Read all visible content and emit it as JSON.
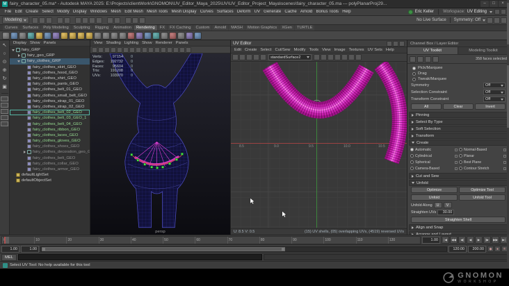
{
  "window": {
    "app_icon": "M",
    "title": "fairy_character_05.ma* - Autodesk MAYA 2025: E:\\Projects\\clientWork\\GNOMON\\UV_Editor_Maya_2025\\UV\\UV_Editor_Project_Maya\\scenes\\fairy_character_05.ma  ---  polyPlanarProj29...",
    "controls": [
      {
        "name": "minimize-button",
        "g": "–"
      },
      {
        "name": "maximize-button",
        "g": "□"
      },
      {
        "name": "close-button",
        "g": "×"
      }
    ]
  },
  "menubar": {
    "items": [
      "File",
      "Edit",
      "Create",
      "Select",
      "Modify",
      "Display",
      "Windows",
      "Mesh",
      "Edit Mesh",
      "Mesh Tools",
      "Mesh Display",
      "Curves",
      "Surfaces",
      "Deform",
      "UV",
      "Generate",
      "Cache",
      "Arnold",
      "Bonus Tools",
      "Help"
    ],
    "user": "Eric Keller",
    "workspace_label": "Workspace:",
    "workspace_value": "UV Editing",
    "right_icons": [
      {
        "name": "workspace-save-icon"
      },
      {
        "name": "workspace-reset-icon"
      }
    ]
  },
  "statusline": {
    "mode": "Modeling",
    "icons": [
      {
        "name": "new-scene-icon"
      },
      {
        "name": "open-scene-icon"
      },
      {
        "name": "save-scene-icon"
      },
      {
        "name": "undo-icon",
        "sep": "sep"
      },
      {
        "name": "redo-icon"
      },
      {
        "name": "snap-grid-icon",
        "sep": "sep"
      },
      {
        "name": "snap-curve-icon"
      },
      {
        "name": "snap-point-icon"
      },
      {
        "name": "snap-plane-icon"
      },
      {
        "name": "make-live-icon",
        "sep": "sep"
      },
      {
        "name": "construction-history-icon"
      },
      {
        "name": "render-frame-icon",
        "sep": "sep"
      },
      {
        "name": "ipr-render-icon"
      },
      {
        "name": "render-settings-icon"
      }
    ],
    "live_surface": "No Live Surface",
    "symmetry": "Symmetry: Off",
    "right_icons": [
      {
        "name": "toggle-attribute-editor-icon"
      },
      {
        "name": "toggle-tool-settings-icon"
      },
      {
        "name": "toggle-channel-box-icon"
      }
    ]
  },
  "shelf": {
    "tabs": [
      {
        "label": "Curves"
      },
      {
        "label": "Surfaces"
      },
      {
        "label": "Poly Modeling"
      },
      {
        "label": "Sculpting"
      },
      {
        "label": "Rigging"
      },
      {
        "label": "Animation"
      },
      {
        "label": "Rendering",
        "state": "active"
      },
      {
        "label": "FX"
      },
      {
        "label": "FX Caching"
      },
      {
        "label": "Custom"
      },
      {
        "label": "Arnold"
      },
      {
        "label": "MASH"
      },
      {
        "label": "Motion Graphics"
      },
      {
        "label": "XGen"
      },
      {
        "label": "TURTLE"
      }
    ],
    "icons": [
      {
        "name": "render-view-icon",
        "c": "c2"
      },
      {
        "name": "ipr-render-icon",
        "c": "c1"
      },
      {
        "name": "render-settings-icon",
        "c": "c2"
      },
      {
        "name": "hypershade-icon",
        "c": "c4"
      },
      {
        "name": "light-editor-icon",
        "c": "c3"
      },
      {
        "name": "standard-surface-icon",
        "c": "c1"
      },
      {
        "name": "ai-standard-surface-icon",
        "c": "c6"
      },
      {
        "name": "area-light-icon",
        "c": "c3"
      },
      {
        "name": "skydome-light-icon",
        "c": "c3"
      },
      {
        "name": "mesh-light-icon",
        "c": "c3"
      },
      {
        "name": "photometric-light-icon",
        "c": "c3"
      },
      {
        "name": "point-light-icon",
        "c": "c2"
      },
      {
        "name": "spot-light-icon",
        "c": "c2"
      },
      {
        "name": "directional-light-icon",
        "c": "c2"
      },
      {
        "name": "ambient-light-icon",
        "c": "c2"
      },
      {
        "name": "volume-light-icon",
        "c": "c5"
      },
      {
        "name": "shadows-icon",
        "c": "c6"
      },
      {
        "name": "raytrace-icon",
        "c": "c1"
      },
      {
        "name": "env-ball-icon",
        "c": "c4"
      },
      {
        "name": "file-texture-icon",
        "c": "c2"
      },
      {
        "name": "ramp-texture-icon",
        "c": "c5"
      },
      {
        "name": "checker-texture-icon",
        "c": "c2"
      },
      {
        "name": "noise-texture-icon",
        "c": "c6"
      },
      {
        "name": "bump-node-icon",
        "c": "c1"
      }
    ]
  },
  "toolbox": {
    "tools": [
      {
        "name": "select-tool-icon",
        "g": "↖"
      },
      {
        "name": "lasso-tool-icon",
        "g": "○"
      },
      {
        "name": "paint-select-tool-icon",
        "g": "⊙"
      },
      {
        "name": "move-tool-icon",
        "g": "⊕"
      },
      {
        "name": "rotate-tool-icon",
        "g": "↻"
      },
      {
        "name": "scale-tool-icon",
        "g": "▣"
      }
    ],
    "layouts": [
      {
        "name": "layout-single-pane"
      },
      {
        "name": "layout-four-pane"
      },
      {
        "name": "layout-two-side"
      },
      {
        "name": "layout-two-stacked"
      },
      {
        "name": "layout-persp-outliner"
      }
    ]
  },
  "outliner": {
    "menus": [
      "Display",
      "Show",
      "Panels"
    ],
    "items": [
      {
        "label": "fairy_GRP",
        "lvl": "l1",
        "arrow": "open",
        "icon": "icon-group"
      },
      {
        "label": "fairy_geo_GRP",
        "lvl": "l2",
        "arrow": "closed",
        "icon": "icon-group"
      },
      {
        "label": "fairy_clothes_GRP",
        "lvl": "l2",
        "arrow": "open",
        "icon": "icon-group",
        "state": "sel-row"
      },
      {
        "label": "fairy_clothes_skirt_GEO",
        "lvl": "l3",
        "arrow": "none",
        "icon": "icon-mesh"
      },
      {
        "label": "fairy_clothes_hood_GEO",
        "lvl": "l3",
        "arrow": "none",
        "icon": "icon-mesh"
      },
      {
        "label": "fairy_clothes_shirt_GEO",
        "lvl": "l3",
        "arrow": "none",
        "icon": "icon-mesh"
      },
      {
        "label": "fairy_clothes_pants_GEO",
        "lvl": "l3",
        "arrow": "none",
        "icon": "icon-mesh"
      },
      {
        "label": "fairy_clothes_belt_01_GEO",
        "lvl": "l3",
        "arrow": "none",
        "icon": "icon-mesh"
      },
      {
        "label": "fairy_clothes_small_belt_GEO",
        "lvl": "l3",
        "arrow": "none",
        "icon": "icon-mesh"
      },
      {
        "label": "fairy_clothes_strap_01_GEO",
        "lvl": "l3",
        "arrow": "none",
        "icon": "icon-mesh"
      },
      {
        "label": "fairy_clothes_strap_02_GEO",
        "lvl": "l3",
        "arrow": "none",
        "icon": "icon-mesh"
      },
      {
        "label": "fairy_clothes_belt_02_GEO",
        "lvl": "l3",
        "arrow": "none",
        "icon": "icon-mesh",
        "state": "active-row grn"
      },
      {
        "label": "fairy_clothes_belt_03_GEO_1",
        "lvl": "l3",
        "arrow": "none",
        "icon": "icon-mesh",
        "state": "grn"
      },
      {
        "label": "fairy_clothes_belt_04_GEO",
        "lvl": "l3",
        "arrow": "none",
        "icon": "icon-mesh",
        "state": "grn"
      },
      {
        "label": "fairy_clothes_ribbon_GEO",
        "lvl": "l3",
        "arrow": "none",
        "icon": "icon-mesh",
        "state": "grn"
      },
      {
        "label": "fairy_clothes_laces_GEO",
        "lvl": "l3",
        "arrow": "none",
        "icon": "icon-mesh",
        "state": "grn"
      },
      {
        "label": "fairy_clothes_gloves_GEO",
        "lvl": "l3",
        "arrow": "none",
        "icon": "icon-mesh",
        "state": "grn"
      },
      {
        "label": "fairy_clothes_shoes_GEO",
        "lvl": "l3",
        "arrow": "none",
        "icon": "icon-mesh",
        "state": "dim"
      },
      {
        "label": "fairy_clothes_decoration_geo_GRP",
        "lvl": "l3",
        "arrow": "closed",
        "icon": "icon-group",
        "state": "dim"
      },
      {
        "label": "fairy_clothes_belt_GEO",
        "lvl": "l3",
        "arrow": "none",
        "icon": "icon-mesh",
        "state": "dim"
      },
      {
        "label": "fairy_clothes_collar_GEO",
        "lvl": "l3",
        "arrow": "none",
        "icon": "icon-mesh",
        "state": "dim"
      },
      {
        "label": "fairy_clothes_armor_GEO",
        "lvl": "l3",
        "arrow": "none",
        "icon": "icon-mesh",
        "state": "dim"
      },
      {
        "label": "defaultLightSet",
        "lvl": "l1",
        "arrow": "none",
        "icon": "icon-set"
      },
      {
        "label": "defaultObjectSet",
        "lvl": "l1",
        "arrow": "none",
        "icon": "icon-set"
      }
    ]
  },
  "viewport": {
    "menus": [
      "View",
      "Shading",
      "Lighting",
      "Show",
      "Renderer",
      "Panels"
    ],
    "icons": [
      {
        "name": "select-camera-icon"
      },
      {
        "name": "lock-camera-icon"
      },
      {
        "name": "camera-attributes-icon"
      },
      {
        "name": "bookmarks-icon"
      },
      {
        "name": "image-plane-icon"
      },
      {
        "name": "2d-pan-zoom-icon"
      },
      {
        "name": "wireframe-mode-icon"
      },
      {
        "name": "shaded-mode-icon"
      },
      {
        "name": "textured-mode-icon"
      },
      {
        "name": "use-all-lights-icon"
      },
      {
        "name": "shadows-icon"
      },
      {
        "name": "screen-space-ao-icon"
      },
      {
        "name": "anti-aliasing-icon"
      },
      {
        "name": "isolate-select-icon"
      },
      {
        "name": "xray-icon"
      },
      {
        "name": "xray-joints-icon"
      }
    ],
    "hud": [
      {
        "label": "Verts:",
        "value": "97154",
        "sel": "0"
      },
      {
        "label": "Edges:",
        "value": "192732",
        "sel": "0"
      },
      {
        "label": "Faces:",
        "value": "95604",
        "sel": "0"
      },
      {
        "label": "Tris:",
        "value": "191208",
        "sel": "0"
      },
      {
        "label": "UVs:",
        "value": "103970",
        "sel": "0"
      }
    ],
    "camera": "persp"
  },
  "uv_editor": {
    "title": "UV Editor",
    "title_icons": [
      {
        "name": "panel-menu-icon"
      },
      {
        "name": "panel-float-icon"
      },
      {
        "name": "panel-close-icon"
      }
    ],
    "menus": [
      "Edit",
      "Create",
      "Select",
      "Cut/Sew",
      "Modify",
      "Tools",
      "View",
      "Image",
      "Textures",
      "UV Sets",
      "Help"
    ],
    "toolbar_icons_a": [
      {
        "name": "uv-grab-icon"
      },
      {
        "name": "uv-flip-u-icon"
      },
      {
        "name": "uv-flip-v-icon"
      },
      {
        "name": "uv-rotate-ccw-icon"
      },
      {
        "name": "uv-rotate-cw-icon"
      }
    ],
    "texture_dropdown": "standardSurface2",
    "toolbar_icons_b": [
      {
        "name": "grid-snap-icon"
      },
      {
        "name": "pixel-snap-icon"
      },
      {
        "name": "texture-borders-icon"
      },
      {
        "name": "checker-map-icon"
      },
      {
        "name": "shade-uvs-icon"
      },
      {
        "name": "distortion-display-icon"
      },
      {
        "name": "isolate-select-icon"
      }
    ],
    "ticks": [
      "8.5",
      "9.0",
      "9.5",
      "10.0",
      "10.5"
    ],
    "coords": "U: 8.5    V: 0.5",
    "stats": "(15) UV shells,  (05) overlapping UVs,  (4519) reversed UVs"
  },
  "toolkit": {
    "tab_top": "Channel Box / Layer Editor",
    "tabs": [
      {
        "label": "UV Toolkit",
        "state": "active"
      },
      {
        "label": "Modeling Toolkit"
      }
    ],
    "mode_icons": [
      {
        "name": "uv-select-mode-icon"
      },
      {
        "name": "edge-select-mode-icon"
      },
      {
        "name": "face-select-mode-icon"
      },
      {
        "name": "shell-select-mode-icon"
      }
    ],
    "selection_info": "358 faces selected",
    "select_modes": [
      {
        "label": "Pick/Marquee",
        "on": "on"
      },
      {
        "label": "Drag"
      },
      {
        "label": "Tweak/Marquee"
      }
    ],
    "symmetry_label": "Symmetry",
    "symmetry_value": "Off",
    "selection_constraint_label": "Selection Constraint",
    "selection_constraint_value": "Off",
    "transform_constraint_label": "Transform Constraint",
    "transform_constraint_value": "Off",
    "select_buttons": [
      "All",
      "Clear",
      "Invert"
    ],
    "sections": [
      {
        "title": "Pinning"
      },
      {
        "title": "Select By Type"
      },
      {
        "title": "Soft Selection"
      },
      {
        "title": "Transform"
      },
      {
        "title": "Create"
      },
      {
        "title": "Cut and Sew"
      },
      {
        "title": "Unfold"
      },
      {
        "title": "Align and Snap"
      },
      {
        "title": "Arrange and Layout"
      }
    ],
    "create_items": [
      {
        "label": "Automatic",
        "on": "on"
      },
      {
        "label": "Normal-Based"
      },
      {
        "label": "Cylindrical"
      },
      {
        "label": "Planar"
      },
      {
        "label": "Spherical"
      },
      {
        "label": "Best Plane"
      },
      {
        "label": "Camera-Based"
      },
      {
        "label": "Contour Stretch"
      }
    ],
    "unfold": {
      "optimize": "Optimize",
      "optimize_tool": "Optimize Tool",
      "unfold": "Unfold",
      "unfold_tool": "Unfold Tool",
      "unfold_along": "Unfold Along",
      "u": "U",
      "v": "V",
      "straighten_uvs": "Straighten UVs",
      "angle": "30.00",
      "straighten_shell": "Straighten Shell"
    }
  },
  "timeline": {
    "ticks": [
      "0",
      "10",
      "20",
      "30",
      "40",
      "50",
      "60",
      "70",
      "80",
      "90",
      "100",
      "110",
      "120"
    ],
    "current": "1.00",
    "transports": [
      {
        "name": "go-to-start-button",
        "g": "|◀"
      },
      {
        "name": "step-back-key-button",
        "g": "◀◀"
      },
      {
        "name": "step-back-frame-button",
        "g": "◀|"
      },
      {
        "name": "play-backwards-button",
        "g": "◀"
      },
      {
        "name": "play-forwards-button",
        "g": "▶"
      },
      {
        "name": "step-forward-frame-button",
        "g": "|▶"
      },
      {
        "name": "step-forward-key-button",
        "g": "▶▶"
      },
      {
        "name": "go-to-end-button",
        "g": "▶|"
      }
    ]
  },
  "rangeslider": {
    "start_outer": "1.00",
    "start_inner": "1.00",
    "end_inner": "120.00",
    "end_outer": "200.00",
    "icons": [
      {
        "name": "playback-options-icon",
        "g": "◆"
      },
      {
        "name": "auto-key-icon",
        "g": "●"
      },
      {
        "name": "animation-preferences-icon",
        "g": "✳"
      }
    ]
  },
  "commandline": {
    "label": "MEL",
    "value": ""
  },
  "helpline": {
    "text": "Select UV Tool: No help available for this tool"
  },
  "logo": {
    "line1": "GNOMON",
    "line2": "WORKSHOP"
  }
}
